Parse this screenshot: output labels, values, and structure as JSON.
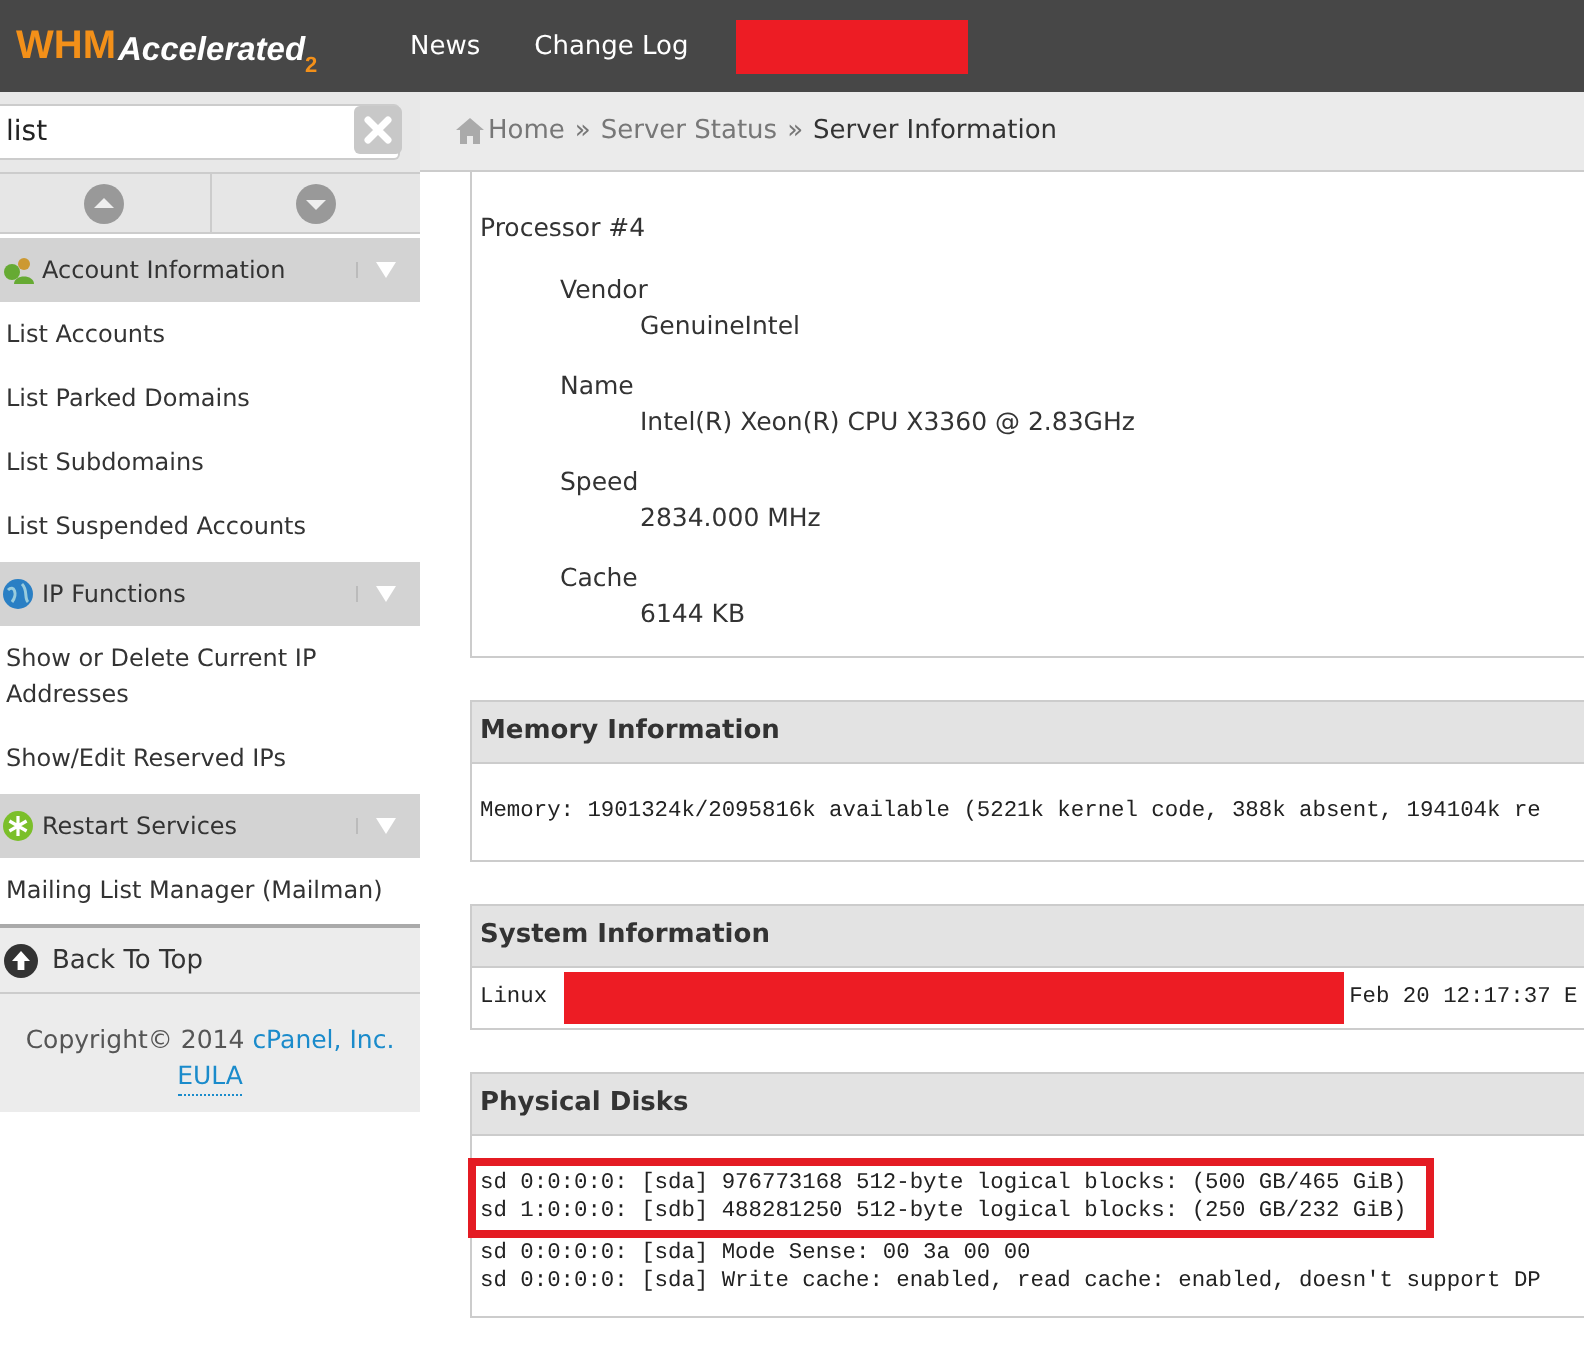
{
  "header": {
    "logo": "WHM",
    "logo_sub": "Accelerated",
    "logo_version": "2",
    "nav": [
      {
        "label": "News"
      },
      {
        "label": "Change Log"
      }
    ],
    "redacted_item": true
  },
  "sidebar": {
    "search": {
      "value": "list"
    },
    "groups": [
      {
        "kind": "accounts",
        "title": "Account Information",
        "items": [
          {
            "label": "List Accounts"
          },
          {
            "label": "List Parked Domains"
          },
          {
            "label": "List Subdomains"
          },
          {
            "label": "List Suspended Accounts"
          }
        ]
      },
      {
        "kind": "ip",
        "title": "IP Functions",
        "items": [
          {
            "label": "Show or Delete Current IP Addresses"
          },
          {
            "label": "Show/Edit Reserved IPs"
          }
        ]
      },
      {
        "kind": "restart",
        "title": "Restart Services",
        "items": [
          {
            "label": "Mailing List Manager (Mailman)"
          }
        ]
      }
    ],
    "back_to_top": "Back To Top",
    "copyright": "Copyright© 2014",
    "company_link": "cPanel, Inc.",
    "eula_link": "EULA"
  },
  "breadcrumb": [
    {
      "label": "Home",
      "link": true
    },
    {
      "label": "Server Status",
      "link": true
    },
    {
      "label": "Server Information",
      "link": false
    }
  ],
  "separator": "»",
  "processor": {
    "title": "Processor #4",
    "fields": [
      {
        "label": "Vendor",
        "value": "GenuineIntel"
      },
      {
        "label": "Name",
        "value": "Intel(R) Xeon(R) CPU X3360 @ 2.83GHz"
      },
      {
        "label": "Speed",
        "value": "2834.000 MHz"
      },
      {
        "label": "Cache",
        "value": "6144 KB"
      }
    ]
  },
  "panels": [
    {
      "title": "Memory Information",
      "lines": [
        {
          "text": "Memory: 1901324k/2095816k available (5221k kernel code, 388k absent, 194104k re"
        }
      ]
    },
    {
      "title": "System Information",
      "lines": [
        {
          "text": "Linux",
          "redacted": true,
          "after": "Feb 20 12:17:37 E"
        }
      ]
    },
    {
      "title": "Physical Disks",
      "highlighted_lines": [
        {
          "text": "sd 0:0:0:0: [sda] 976773168 512-byte logical blocks: (500 GB/465 GiB)"
        },
        {
          "text": "sd 1:0:0:0: [sdb] 488281250 512-byte logical blocks: (250 GB/232 GiB)"
        }
      ],
      "lines": [
        {
          "text": "sd 0:0:0:0: [sda] Mode Sense: 00 3a 00 00"
        },
        {
          "text": "sd 0:0:0:0: [sda] Write cache: enabled, read cache: enabled, doesn't support DP"
        }
      ]
    }
  ]
}
